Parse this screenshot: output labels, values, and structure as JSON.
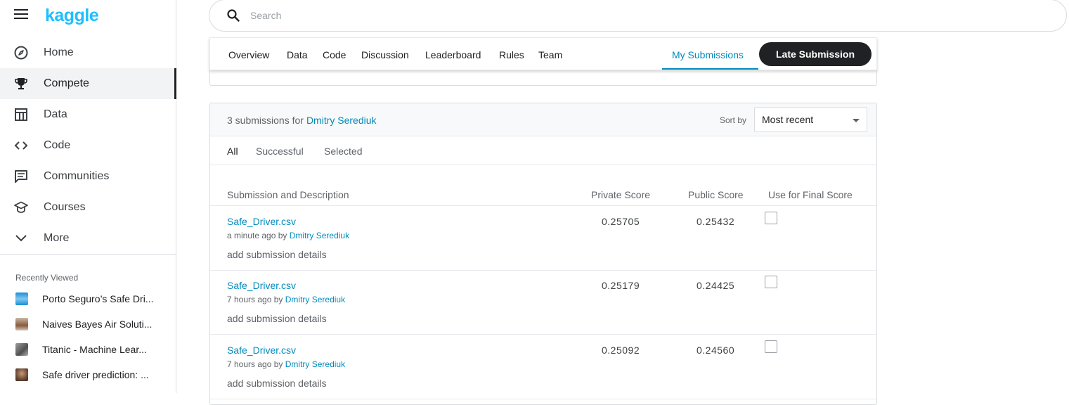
{
  "app": {
    "logo": "kaggle"
  },
  "sidebar": {
    "items": [
      {
        "label": "Home",
        "icon": "compass-icon"
      },
      {
        "label": "Compete",
        "icon": "trophy-icon",
        "active": true
      },
      {
        "label": "Data",
        "icon": "table-icon"
      },
      {
        "label": "Code",
        "icon": "code-icon"
      },
      {
        "label": "Communities",
        "icon": "comments-icon"
      },
      {
        "label": "Courses",
        "icon": "graduation-cap-icon"
      },
      {
        "label": "More",
        "icon": "chevron-down-icon"
      }
    ],
    "recent_title": "Recently Viewed",
    "recent": [
      {
        "label": "Porto Seguro’s Safe Dri..."
      },
      {
        "label": "Naives Bayes Air Soluti..."
      },
      {
        "label": "Titanic - Machine Lear..."
      },
      {
        "label": "Safe driver prediction: ..."
      }
    ]
  },
  "search": {
    "placeholder": "Search",
    "value": ""
  },
  "tabs": {
    "items": [
      "Overview",
      "Data",
      "Code",
      "Discussion",
      "Leaderboard",
      "Rules",
      "Team"
    ],
    "my_submissions": "My Submissions",
    "late_submission": "Late Submission"
  },
  "submissions": {
    "count_text": "3 submissions for",
    "user": "Dmitry Serediuk",
    "sort_label": "Sort by",
    "sort_value": "Most recent",
    "filters": [
      "All",
      "Successful",
      "Selected"
    ],
    "columns": {
      "description": "Submission and Description",
      "private": "Private Score",
      "public": "Public Score",
      "final": "Use for Final Score"
    },
    "rows": [
      {
        "file": "Safe_Driver.csv",
        "time": "a minute ago by",
        "user": "Dmitry Serediuk",
        "details": "add submission details",
        "private": "0.25705",
        "public": "0.25432"
      },
      {
        "file": "Safe_Driver.csv",
        "time": "7 hours ago by",
        "user": "Dmitry Serediuk",
        "details": "add submission details",
        "private": "0.25179",
        "public": "0.24425"
      },
      {
        "file": "Safe_Driver.csv",
        "time": "7 hours ago by",
        "user": "Dmitry Serediuk",
        "details": "add submission details",
        "private": "0.25092",
        "public": "0.24560"
      }
    ]
  },
  "colors": {
    "accent": "#008abc",
    "logo": "#20beff",
    "dark": "#202124"
  }
}
